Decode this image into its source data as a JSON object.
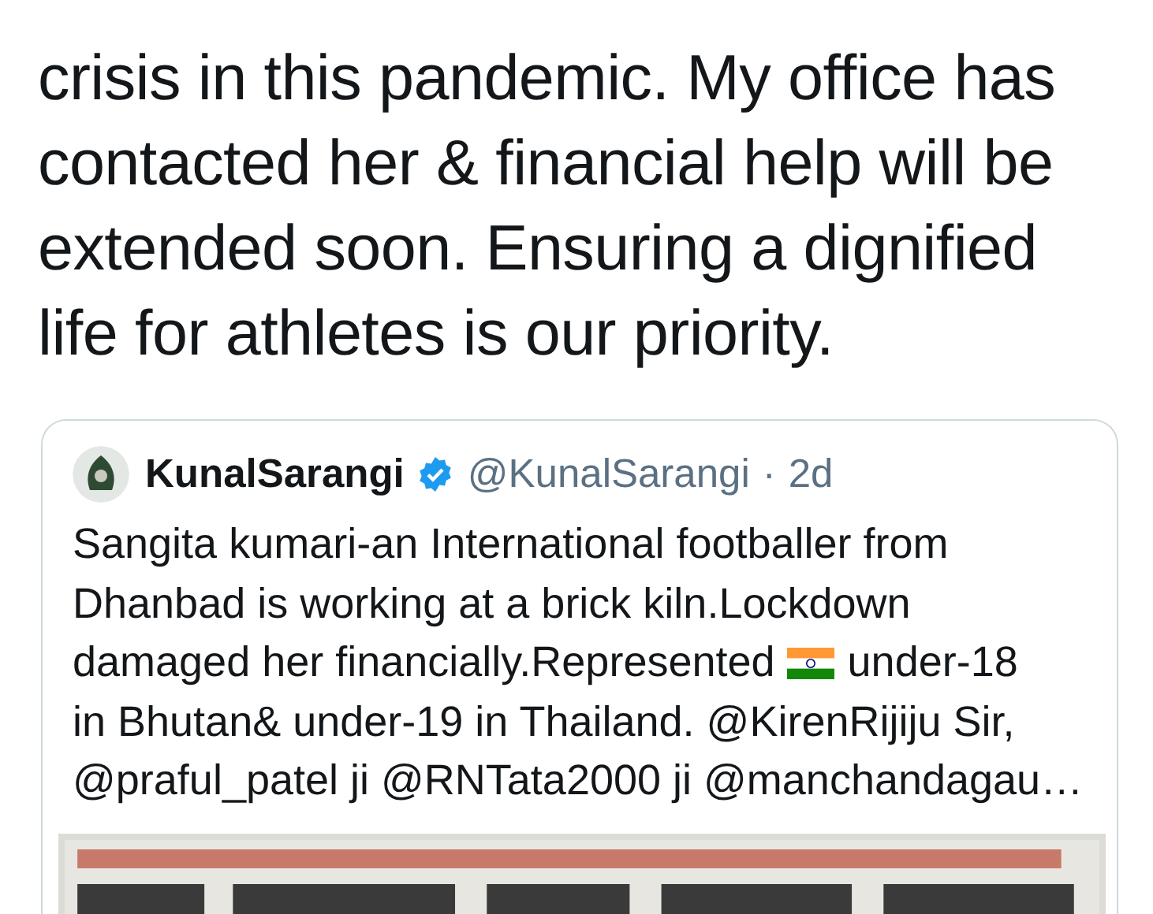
{
  "tweet": {
    "text": "crisis in this pandemic. My office has\ncontacted her & financial help will be\nextended soon. Ensuring a dignified\nlife for athletes is our priority."
  },
  "quoted_tweet": {
    "name": "KunalSarangi",
    "verified": true,
    "handle": "@KunalSarangi",
    "separator": "·",
    "time": "2d",
    "lines": [
      {
        "kind": "text",
        "text": "Sangita kumari-an International footballer from"
      },
      {
        "kind": "text",
        "text": "Dhanbad is working at a brick kiln.Lockdown"
      },
      {
        "kind": "flag",
        "before": "damaged her financially.Represented",
        "after": "under-18"
      },
      {
        "kind": "text",
        "text": "in Bhutan& under-19 in Thailand. @KirenRijiju Sir,"
      },
      {
        "kind": "text",
        "text": "@praful_patel ji @RNTata2000 ji @manchandagau…"
      }
    ]
  }
}
